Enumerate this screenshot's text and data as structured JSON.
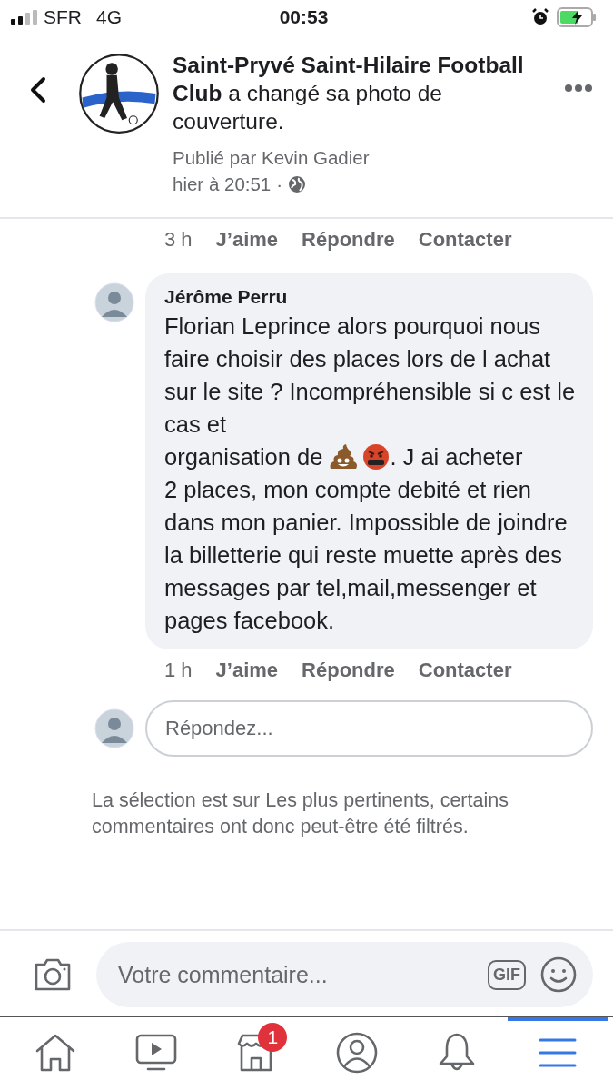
{
  "status_bar": {
    "carrier": "SFR",
    "network": "4G",
    "time": "00:53"
  },
  "post_header": {
    "page_name": "Saint-Pryvé Saint-Hilaire Football Club",
    "action": "a changé sa photo de couverture.",
    "published_by": "Publié par Kevin Gadier",
    "time": "hier à 20:51",
    "separator": "·"
  },
  "previous_comment_actions": {
    "age": "3 h",
    "like": "J’aime",
    "reply": "Répondre",
    "contact": "Contacter"
  },
  "comment": {
    "author": "Jérôme Perru",
    "text_1": "Florian Leprince alors pourquoi nous faire choisir des places lors de l achat sur le site ? Incompréhensible si c est le cas et",
    "text_2": "organisation de",
    "text_3": ". J ai acheter",
    "text_4": "2 places, mon compte debité et rien dans mon panier. Impossible de joindre la billetterie qui reste muette après des messages par tel,mail,messenger et pages facebook.",
    "age": "1 h",
    "like": "J’aime",
    "reply": "Répondre",
    "contact": "Contacter"
  },
  "reply_field": {
    "placeholder": "Répondez..."
  },
  "filter_note": "La sélection est sur Les plus pertinents, certains commentaires ont donc peut-être été filtrés.",
  "composer": {
    "placeholder": "Votre commentaire...",
    "gif": "GIF"
  },
  "tabs": [
    {
      "kind": "home",
      "selected": false
    },
    {
      "kind": "video",
      "selected": false
    },
    {
      "kind": "marketplace",
      "selected": false,
      "badge": "1"
    },
    {
      "kind": "profile",
      "selected": false
    },
    {
      "kind": "notifications",
      "selected": false
    },
    {
      "kind": "menu",
      "selected": true
    }
  ]
}
